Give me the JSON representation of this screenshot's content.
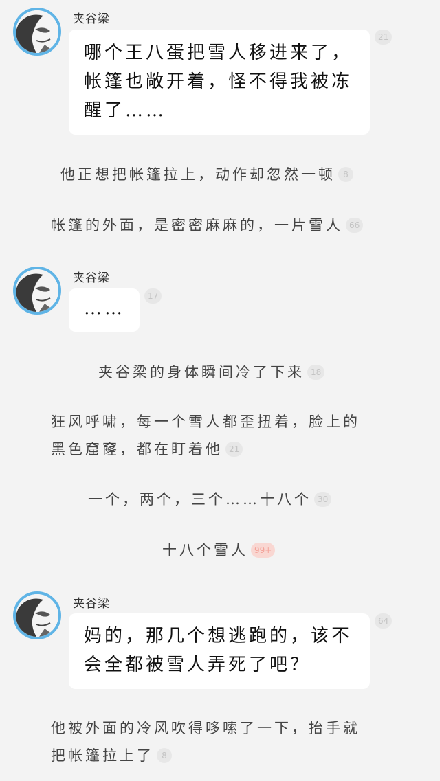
{
  "speaker": "夹谷梁",
  "messages": [
    {
      "text_lines": [
        "哪个王八蛋把雪人移进来了，",
        "帐篷也敞开着，怪不得我被冻",
        "醒了……"
      ],
      "badge": "21"
    },
    {
      "text_lines": [
        "……"
      ],
      "badge": "17"
    },
    {
      "text_lines": [
        "妈的，那几个想逃跑的，该不",
        "会全都被雪人弄死了吧？"
      ],
      "badge": "64"
    }
  ],
  "narrations": [
    {
      "lines": [
        "他正想把帐篷拉上，动作却忽然一顿"
      ],
      "badge": "8"
    },
    {
      "lines": [
        "帐篷的外面，是密密麻麻的，一片雪人"
      ],
      "badge": "66"
    },
    {
      "lines": [
        "夹谷梁的身体瞬间冷了下来"
      ],
      "badge": "18"
    },
    {
      "lines": [
        "狂风呼啸，每一个雪人都歪扭着，脸上的",
        "黑色窟窿，都在盯着他"
      ],
      "badge": "21"
    },
    {
      "lines": [
        "一个，两个，三个……十八个"
      ],
      "badge": "30"
    },
    {
      "lines": [
        "十八个雪人"
      ],
      "badge": "99+"
    },
    {
      "lines": [
        "他被外面的冷风吹得哆嗦了一下，抬手就",
        "把帐篷拉上了"
      ],
      "badge": "8"
    }
  ],
  "colors": {
    "avatar_ring": "#5fb4e6",
    "badge_bg": "#e7e7e7",
    "badge_text": "#c4c4c4",
    "hot_badge_bg": "#f9d7d2",
    "hot_badge_text": "#f3a39a",
    "background": "#f3f3f3",
    "bubble": "#ffffff"
  }
}
